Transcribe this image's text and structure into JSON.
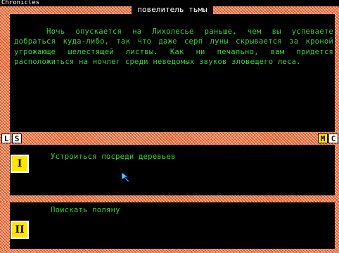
{
  "header": {
    "game_title": "Chronicles",
    "title": "повелитель тьмы"
  },
  "story": {
    "text": "Ночь опускается на Лихолесье раньше, чем вы успеваете добраться куда-либо, так что даже серп луны скрывается за кроной угрожающе шелестящей листвы. Как ни печально, вам придется расположиться на ночлег среди неведомых звуков зловещего леса."
  },
  "toolbar": {
    "left_buttons": [
      "L",
      "S"
    ],
    "right_buttons": [
      "M",
      "C"
    ]
  },
  "choices": [
    {
      "number": "I",
      "text": "Устроиться посреди деревьев"
    },
    {
      "number": "II",
      "text": "Поискать поляну"
    }
  ],
  "colors": {
    "text": "#33d633",
    "border": "#e0541c",
    "badge": "#ffe600"
  }
}
